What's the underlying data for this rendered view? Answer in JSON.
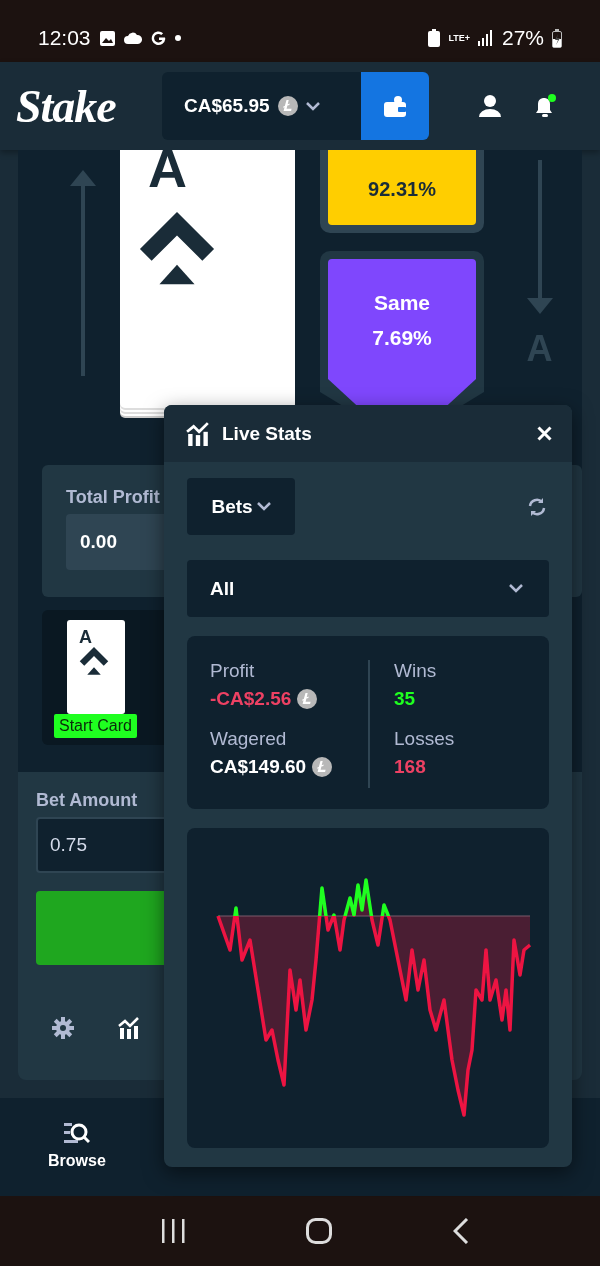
{
  "status_bar": {
    "time": "12:03",
    "network": "LTE+",
    "battery": "27%"
  },
  "header": {
    "logo": "Stake",
    "balance": "CA$65.95"
  },
  "game": {
    "card_rank": "A",
    "higher_chance": "92.31%",
    "same_label": "Same",
    "same_chance": "7.69%",
    "next_rank": "A"
  },
  "total_profit": {
    "label": "Total Profit",
    "value": "0.00"
  },
  "start_card": {
    "rank": "A",
    "label": "Start Card"
  },
  "bet_amount": {
    "label": "Bet Amount",
    "value": "0.75"
  },
  "bottom_nav": [
    {
      "label": "Browse",
      "selected": true
    }
  ],
  "live_stats": {
    "title": "Live Stats",
    "filter": "Bets",
    "range": "All",
    "profit_label": "Profit",
    "profit": "-CA$2.56",
    "wagered_label": "Wagered",
    "wagered": "CA$149.60",
    "wins_label": "Wins",
    "wins": "35",
    "losses_label": "Losses",
    "losses": "168"
  }
}
